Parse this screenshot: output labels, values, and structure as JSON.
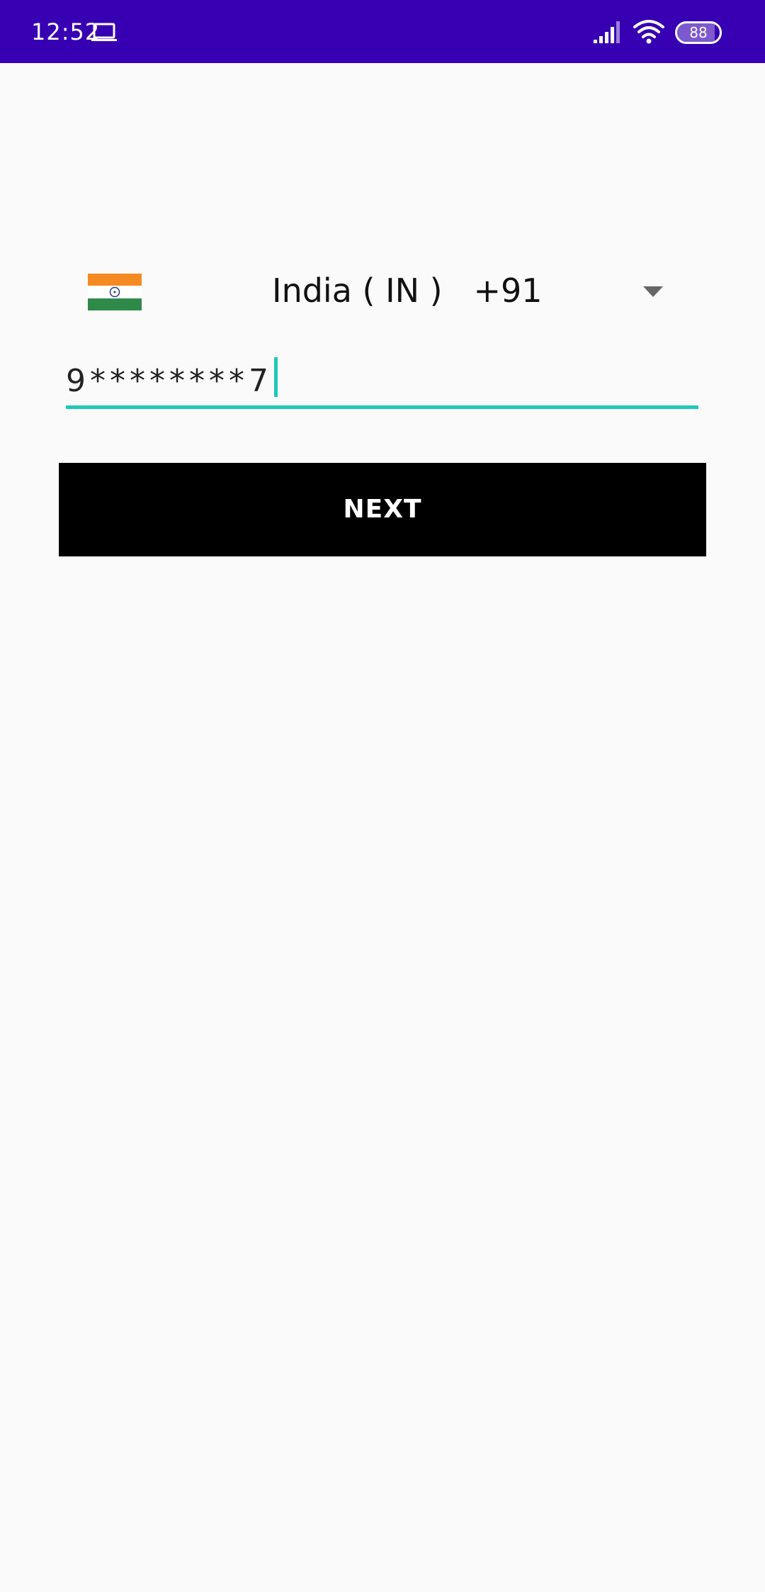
{
  "status_bar": {
    "time": "12:52",
    "battery_level": "88",
    "battery_percent": 88,
    "background_color": "#3700b3",
    "icons": [
      "laptop-icon",
      "signal-icon",
      "wifi-icon",
      "battery-icon"
    ]
  },
  "country_selector": {
    "flag_icon": "india-flag-icon",
    "label": "India ( IN )   +91",
    "dropdown_icon": "dropdown-arrow-icon"
  },
  "phone_input": {
    "value": "9********7",
    "accent_color": "#1ec8b8"
  },
  "next_button": {
    "label": "NEXT"
  }
}
